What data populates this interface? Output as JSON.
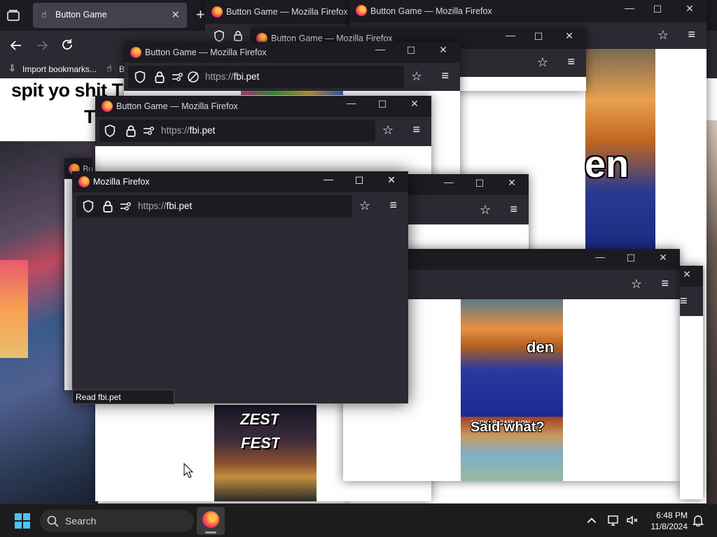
{
  "background_browser": {
    "tab_title": "Button Game",
    "bookmarks_bar": {
      "import_label": "Import bookmarks...",
      "truncated_label": "B"
    },
    "page_text_line1": "spit yo shit T",
    "page_text_line2": "T"
  },
  "windows": {
    "w1": {
      "title": "Button Game — Mozilla Firefox"
    },
    "w2": {
      "title": "Button Game — Mozilla Firefox"
    },
    "w3": {
      "title": "Button Game — Mozilla Firefox"
    },
    "w4": {
      "title": "Button Game — Mozilla Firefox",
      "url_scheme": "https://",
      "url_host": "fbi.pet"
    },
    "w5": {
      "title": "Button Game — Mozilla Firefox",
      "url_scheme": "https://",
      "url_host": "fbi.pet"
    },
    "w6": {
      "title_truncated": "Bu"
    },
    "top": {
      "title": "Mozilla Firefox",
      "url_scheme": "https://",
      "url_host": "fbi.pet",
      "status_text": "Read fbi.pet"
    }
  },
  "meme_text": {
    "en_big": "en",
    "den": "den",
    "said_what": "Said what?",
    "zest": "ZEST",
    "fest": "FEST",
    "sucker": "SUCKER CARLSON"
  },
  "taskbar": {
    "search_label": "Search",
    "time": "6:48 PM",
    "date": "11/8/2024"
  },
  "colors": {
    "titlebar": "#1c1b22",
    "toolbar": "#2b2a33",
    "page_bg": "#ffffff",
    "taskbar": "#1c1c1c"
  },
  "icons": [
    "firefox-icon",
    "shield-icon",
    "lock-icon",
    "permissions-icon",
    "tracking-off-icon",
    "star-icon",
    "hamburger-menu-icon",
    "minimize-icon",
    "maximize-icon",
    "close-icon",
    "windows-start-icon",
    "search-icon",
    "chevron-up-icon",
    "network-icon",
    "volume-muted-icon",
    "notification-bell-icon",
    "back-icon",
    "forward-icon",
    "reload-icon",
    "tab-list-icon",
    "new-tab-icon"
  ]
}
